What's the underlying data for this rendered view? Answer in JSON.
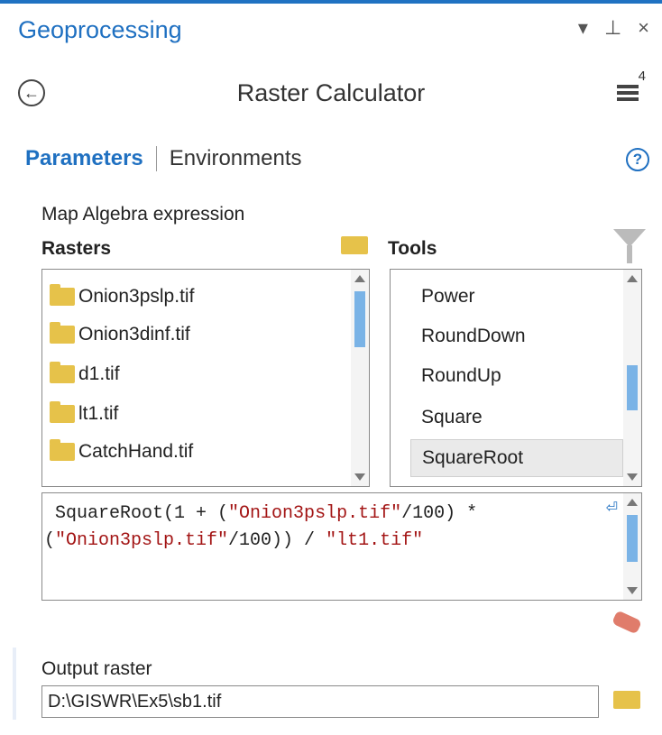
{
  "pane": {
    "title": "Geoprocessing",
    "controls": [
      "▾",
      "⊥",
      "×"
    ]
  },
  "header": {
    "back_icon": "←",
    "tool_title": "Raster Calculator",
    "menu_badge": "4"
  },
  "tabs": {
    "parameters": "Parameters",
    "environments": "Environments",
    "help_icon": "?"
  },
  "params": {
    "expression_label": "Map Algebra expression",
    "rasters_label": "Rasters",
    "tools_label": "Tools",
    "rasters": [
      "Onion3pslp.tif",
      "Onion3dinf.tif",
      "d1.tif",
      "lt1.tif",
      "CatchHand.tif"
    ],
    "tools": [
      "Power",
      "RoundDown",
      "RoundUp",
      "Square",
      "SquareRoot"
    ],
    "selected_tool": "SquareRoot",
    "expression": {
      "part1": " SquareRoot(1 + (",
      "s1": "\"Onion3pslp.tif\"",
      "part2": "/100) *\n(",
      "s2": "\"Onion3pslp.tif\"",
      "part3": "/100)) / ",
      "s3": "\"lt1.tif\""
    },
    "output_label": "Output raster",
    "output_value": "D:\\GISWR\\Ex5\\sb1.tif"
  },
  "colors": {
    "accent": "#1f70c1",
    "folder": "#e6c24a",
    "string": "#a31515",
    "selection": "#eaeaea"
  }
}
